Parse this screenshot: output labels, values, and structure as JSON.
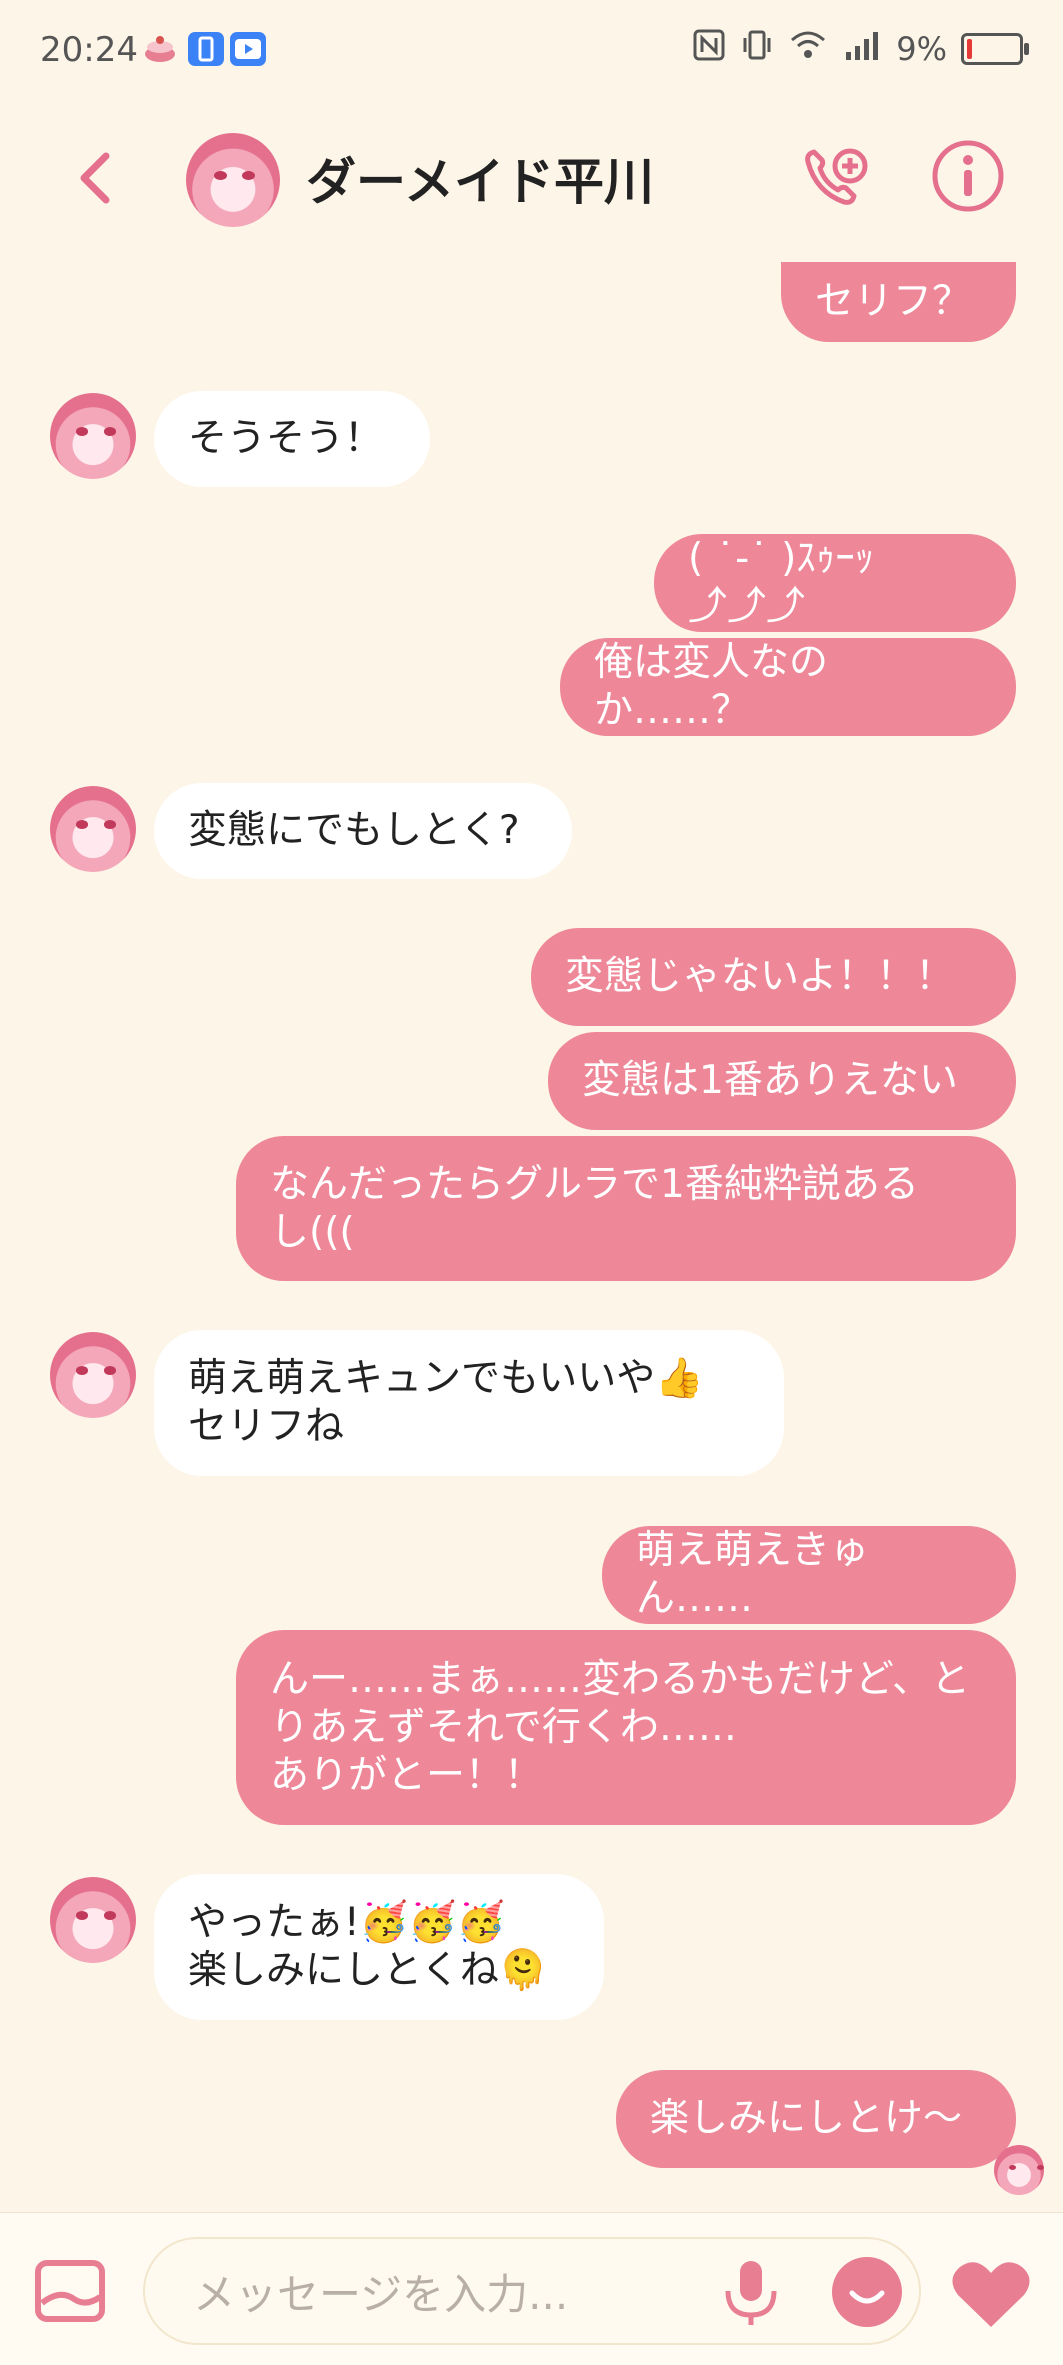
{
  "status_bar": {
    "time": "20:24",
    "battery_text": "9%",
    "battery_level": 0.09,
    "icons": [
      "cake-icon",
      "phone-manager-icon",
      "youtube-icon",
      "nfc-icon",
      "vibrate-icon",
      "wifi-icon",
      "signal-icon",
      "battery-icon"
    ]
  },
  "header": {
    "contact_name": "ダーメイド平川",
    "accent_color": "#e5708e"
  },
  "messages": [
    {
      "side": "out",
      "text": "セリフ？"
    },
    {
      "side": "in",
      "text": "そうそう！"
    },
    {
      "side": "out",
      "text": "( ˙-˙ )ｽｩｰｯ⤴︎⤴︎⤴︎"
    },
    {
      "side": "out",
      "text": "俺は変人なのか……？"
    },
    {
      "side": "in",
      "text": "変態にでもしとく?"
    },
    {
      "side": "out",
      "text": "変態じゃないよ！！！"
    },
    {
      "side": "out",
      "text": "変態は1番ありえない"
    },
    {
      "side": "out",
      "text": "なんだったらグルラで1番純粋説ある\nし((("
    },
    {
      "side": "in",
      "text": "萌え萌えキュンでもいいや👍\nセリフね"
    },
    {
      "side": "out",
      "text": "萌え萌えきゅん……"
    },
    {
      "side": "out",
      "text": "んー……まぁ……変わるかもだけど、と\nりあえずそれで行くわ……\nありがとー！！"
    },
    {
      "side": "in",
      "text": "やったぁ!🥳🥳🥳\n楽しみにしとくね🫠"
    },
    {
      "side": "out",
      "text": "楽しみにしとけ〜"
    }
  ],
  "input": {
    "placeholder": "メッセージを入力..."
  },
  "colors": {
    "background": "#fdf6e8",
    "outgoing_bubble": "#ee8898",
    "incoming_bubble": "#ffffff",
    "icon_accent": "#e87e92"
  }
}
